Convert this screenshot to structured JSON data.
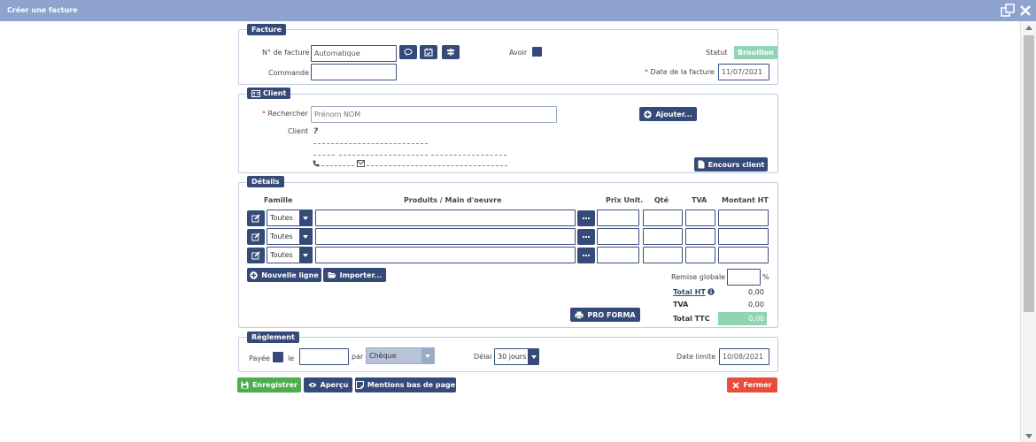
{
  "window": {
    "title": "Créer une facture"
  },
  "facture": {
    "legend": "Facture",
    "invoice_no_label": "N° de facture",
    "invoice_no_value": "Automatique",
    "command_label": "Commande",
    "command_value": "",
    "avoir_label": "Avoir",
    "statut_label": "Statut",
    "statut_value": "Brouillon",
    "date_label": "Date de la facture",
    "date_required": "*",
    "date_value": "11/07/2021"
  },
  "client": {
    "legend": "Client",
    "search_label": "Rechercher",
    "search_required": "*",
    "search_placeholder": "Prénom NOM",
    "add_button": "Ajouter...",
    "client_label": "Client",
    "client_value": "?",
    "encours_button": "Encours client"
  },
  "details": {
    "legend": "Détails",
    "columns": [
      "Famille",
      "Produits / Main d'oeuvre",
      "Prix Unit.",
      "Qté",
      "TVA",
      "Montant HT"
    ],
    "rows": [
      {
        "famille": "Toutes"
      },
      {
        "famille": "Toutes"
      },
      {
        "famille": "Toutes"
      }
    ],
    "new_line_button": "Nouvelle ligne",
    "import_button": "Importer...",
    "remise_label": "Remise globale",
    "remise_unit": "%",
    "remise_value": "",
    "proforma_button": "PRO FORMA",
    "total_ht_label": "Total HT",
    "total_ht_value": "0,00",
    "tva_label": "TVA",
    "tva_value": "0,00",
    "total_ttc_label": "Total TTC",
    "total_ttc_value": "0,00"
  },
  "reglement": {
    "legend": "Règlement",
    "payee_label": "Payée",
    "le_label": "le",
    "date_value": "",
    "par_label": "par",
    "method_value": "Chèque",
    "delai_label": "Délai",
    "delai_value": "30 jours",
    "date_limite_label": "Date limite",
    "date_limite_value": "10/08/2021"
  },
  "footer": {
    "save_button": "Enregistrer",
    "preview_button": "Aperçu",
    "mentions_button": "Mentions bas de page",
    "close_button": "Fermer"
  },
  "colors": {
    "title_bar": "#8fa3cf",
    "primary": "#354a78",
    "save": "#4cae4c",
    "close": "#e74c3c",
    "status": "#8fd4b5"
  }
}
